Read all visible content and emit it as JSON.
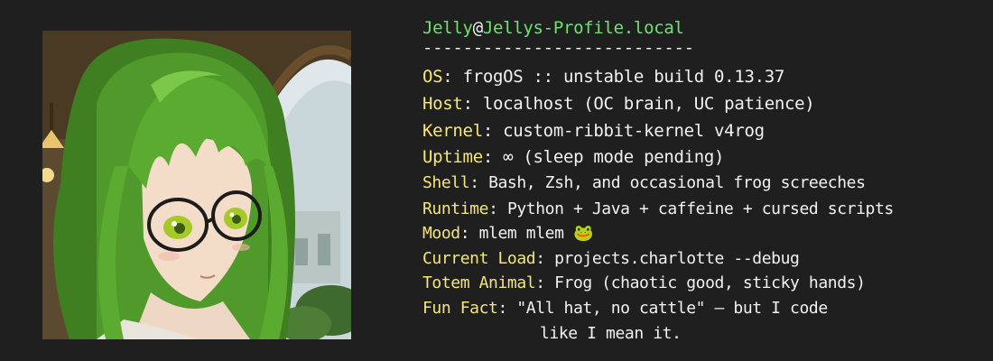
{
  "header": {
    "user": "Jelly",
    "at": "@",
    "host": "Jellys-Profile.local",
    "separator": "---------------------------"
  },
  "fields": [
    {
      "key": "OS",
      "value": "frogOS :: unstable build 0.13.37"
    },
    {
      "key": "Host",
      "value": "localhost (OC brain, UC patience)"
    },
    {
      "key": "Kernel",
      "value": "custom-ribbit-kernel v4rog"
    },
    {
      "key": "Uptime",
      "value": "∞ (sleep mode pending)"
    },
    {
      "key": "Shell",
      "value": "Bash, Zsh, and occasional frog screeches"
    },
    {
      "key": "Runtime",
      "value": "Python + Java + caffeine + cursed scripts"
    },
    {
      "key": "Mood",
      "value": "mlem mlem 🐸"
    },
    {
      "key": "Current Load",
      "value": "projects.charlotte --debug"
    },
    {
      "key": "Totem Animal",
      "value": "Frog (chaotic good, sticky hands)"
    },
    {
      "key": "Fun Fact",
      "value": "\"All hat, no cattle\" — but I code",
      "continuation": "like I mean it."
    }
  ],
  "colors": {
    "background": "#1f1f1f",
    "host_green": "#6ee36e",
    "key_yellow": "#f5e67a",
    "text_white": "#f2f2f2"
  },
  "avatar": {
    "icon": "anime-girl-avatar-image"
  }
}
